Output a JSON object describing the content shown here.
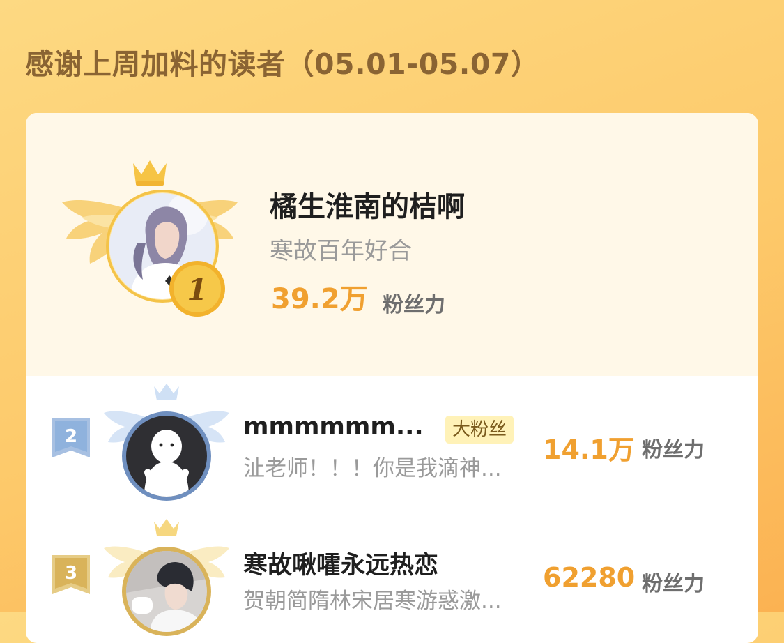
{
  "page": {
    "title": "感谢上周加料的读者（05.01-05.07）"
  },
  "leaderboard": [
    {
      "rank": "1",
      "name": "橘生淮南的桔啊",
      "subtitle": "寒故百年好合",
      "score": "39.2万",
      "score_unit": "粉丝力",
      "badge": ""
    },
    {
      "rank": "2",
      "name": "mmmmmm...",
      "subtitle": "沚老师！！！你是我滴神...",
      "score": "14.1万",
      "score_unit": "粉丝力",
      "badge": "大粉丝"
    },
    {
      "rank": "3",
      "name": "寒故啾嚯永远热恋",
      "subtitle": "贺朝简隋林宋居寒游惑激...",
      "score": "62280",
      "score_unit": "粉丝力",
      "badge": ""
    }
  ],
  "colors": {
    "gold": "#f0a030",
    "title_brown": "#8a6433",
    "silver_blue": "#8fb2dd",
    "bronze_gold": "#d9b35a"
  },
  "icons": {
    "crown": "crown-icon",
    "wings": "wings-icon"
  }
}
